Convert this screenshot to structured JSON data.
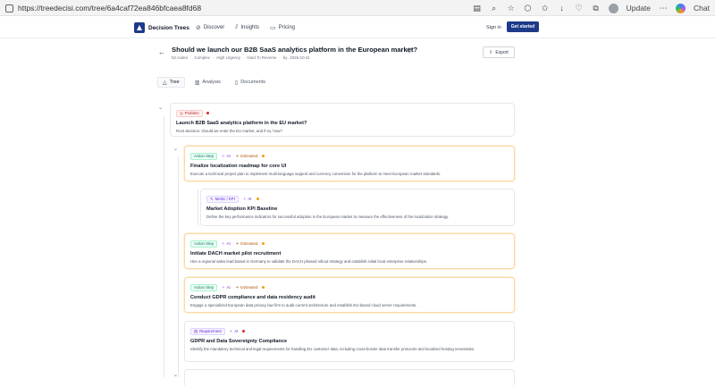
{
  "browser": {
    "url": "https://treedecisi.com/tree/6a4caf72ea846bfcaea8fd68",
    "update_label": "Update",
    "chat_label": "Chat"
  },
  "header": {
    "brand": "Decision Trees",
    "nav": [
      {
        "label": "Discover",
        "icon": "compass-icon"
      },
      {
        "label": "Insights",
        "icon": "chart-icon"
      },
      {
        "label": "Pricing",
        "icon": "card-icon"
      }
    ],
    "sign_in": "Sign in",
    "get_started": "Get started"
  },
  "title_bar": {
    "title": "Should we launch our B2B SaaS analytics platform in the European market?",
    "meta": [
      "52 nodes",
      "·",
      "Complex",
      "·",
      "High Urgency",
      "·",
      "Hard To Reverse",
      "·",
      "by",
      "2026-10-21"
    ],
    "export_label": "Export"
  },
  "tabs": [
    {
      "label": "Tree",
      "icon": "tree-icon",
      "active": true
    },
    {
      "label": "Analysis",
      "icon": "bar-chart-icon",
      "active": false
    },
    {
      "label": "Documents",
      "icon": "document-icon",
      "active": false
    }
  ],
  "nodes": [
    {
      "type": "problem",
      "type_label": "Problem",
      "badges": [],
      "dot": "red",
      "title": "Launch B2B SaaS analytics platform in the EU market?",
      "description": "Root decision: should we enter the EU market, and if so, how?"
    },
    {
      "type": "action",
      "type_label": "Action Step",
      "badges": [
        "AI",
        "Estimated"
      ],
      "dot": "amber",
      "title": "Finalize localization roadmap for core UI",
      "description": "Execute a technical project plan to implement multi-language support and currency conversion for the platform to meet European market standards."
    },
    {
      "type": "metric",
      "type_label": "Metric / KPI",
      "badges": [
        "AI"
      ],
      "dot": "amber",
      "title": "Market Adoption KPI Baseline",
      "description": "Define the key performance indicators for successful adoption in the European market to measure the effectiveness of the localization strategy."
    },
    {
      "type": "action",
      "type_label": "Action Step",
      "badges": [
        "AI",
        "Estimated"
      ],
      "dot": "amber",
      "title": "Initiate DACH market pilot recruitment",
      "description": "Hire a regional sales lead based in Germany to validate the DACH phased rollout strategy and establish initial local enterprise relationships."
    },
    {
      "type": "action",
      "type_label": "Action Step",
      "badges": [
        "AI",
        "Estimated"
      ],
      "dot": "amber",
      "title": "Conduct GDPR compliance and data residency audit",
      "description": "Engage a specialized European data privacy law firm to audit current architecture and establish EU-based cloud server requirements."
    },
    {
      "type": "requirement",
      "type_label": "Requirement",
      "badges": [
        "AI"
      ],
      "dot": "red",
      "title": "GDPR and Data Sovereignty Compliance",
      "description": "Identify the mandatory technical and legal requirements for handling EU customer data, including cross-border data transfer protocols and localized hosting necessities."
    }
  ]
}
